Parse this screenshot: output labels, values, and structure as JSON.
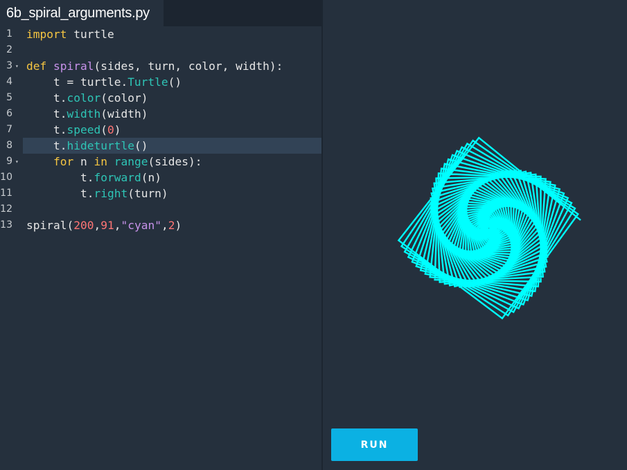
{
  "editor": {
    "filename": "6b_spiral_arguments.py",
    "lines": [
      {
        "num": "1",
        "fold": false,
        "tokens": [
          {
            "t": "import",
            "c": "kw"
          },
          {
            "t": " turtle",
            "c": "plain"
          }
        ]
      },
      {
        "num": "2",
        "fold": false,
        "tokens": []
      },
      {
        "num": "3",
        "fold": true,
        "tokens": [
          {
            "t": "def",
            "c": "kw"
          },
          {
            "t": " ",
            "c": "plain"
          },
          {
            "t": "spiral",
            "c": "fn"
          },
          {
            "t": "(sides, turn, color, width):",
            "c": "plain"
          }
        ]
      },
      {
        "num": "4",
        "fold": false,
        "tokens": [
          {
            "t": "    t = turtle.",
            "c": "plain"
          },
          {
            "t": "Turtle",
            "c": "meth"
          },
          {
            "t": "()",
            "c": "plain"
          }
        ]
      },
      {
        "num": "5",
        "fold": false,
        "tokens": [
          {
            "t": "    t.",
            "c": "plain"
          },
          {
            "t": "color",
            "c": "meth"
          },
          {
            "t": "(color)",
            "c": "plain"
          }
        ]
      },
      {
        "num": "6",
        "fold": false,
        "tokens": [
          {
            "t": "    t.",
            "c": "plain"
          },
          {
            "t": "width",
            "c": "meth"
          },
          {
            "t": "(width)",
            "c": "plain"
          }
        ]
      },
      {
        "num": "7",
        "fold": false,
        "tokens": [
          {
            "t": "    t.",
            "c": "plain"
          },
          {
            "t": "speed",
            "c": "meth"
          },
          {
            "t": "(",
            "c": "plain"
          },
          {
            "t": "0",
            "c": "num"
          },
          {
            "t": ")",
            "c": "plain"
          }
        ]
      },
      {
        "num": "8",
        "fold": false,
        "active": true,
        "tokens": [
          {
            "t": "    t.",
            "c": "plain"
          },
          {
            "t": "hideturtle",
            "c": "meth"
          },
          {
            "t": "()",
            "c": "plain"
          }
        ]
      },
      {
        "num": "9",
        "fold": true,
        "tokens": [
          {
            "t": "    ",
            "c": "plain"
          },
          {
            "t": "for",
            "c": "kw"
          },
          {
            "t": " n ",
            "c": "plain"
          },
          {
            "t": "in",
            "c": "kw"
          },
          {
            "t": " ",
            "c": "plain"
          },
          {
            "t": "range",
            "c": "meth"
          },
          {
            "t": "(sides):",
            "c": "plain"
          }
        ]
      },
      {
        "num": "10",
        "fold": false,
        "tokens": [
          {
            "t": "        t.",
            "c": "plain"
          },
          {
            "t": "forward",
            "c": "meth"
          },
          {
            "t": "(n)",
            "c": "plain"
          }
        ]
      },
      {
        "num": "11",
        "fold": false,
        "tokens": [
          {
            "t": "        t.",
            "c": "plain"
          },
          {
            "t": "right",
            "c": "meth"
          },
          {
            "t": "(turn)",
            "c": "plain"
          }
        ]
      },
      {
        "num": "12",
        "fold": false,
        "tokens": []
      },
      {
        "num": "13",
        "fold": false,
        "tokens": [
          {
            "t": "spiral(",
            "c": "plain"
          },
          {
            "t": "200",
            "c": "num"
          },
          {
            "t": ",",
            "c": "plain"
          },
          {
            "t": "91",
            "c": "num"
          },
          {
            "t": ",",
            "c": "plain"
          },
          {
            "t": "\"cyan\"",
            "c": "str"
          },
          {
            "t": ",",
            "c": "plain"
          },
          {
            "t": "2",
            "c": "num"
          },
          {
            "t": ")",
            "c": "plain"
          }
        ]
      }
    ]
  },
  "output": {
    "spiral": {
      "sides": 200,
      "turn": 91,
      "color": "#00ffff"
    }
  },
  "run_button": {
    "label": "RUN"
  },
  "colors": {
    "background": "#25303d",
    "accent": "#0bb1e3",
    "keyword": "#f5c542",
    "function": "#c792ea",
    "method": "#2ec5b6",
    "number": "#ff7575"
  }
}
